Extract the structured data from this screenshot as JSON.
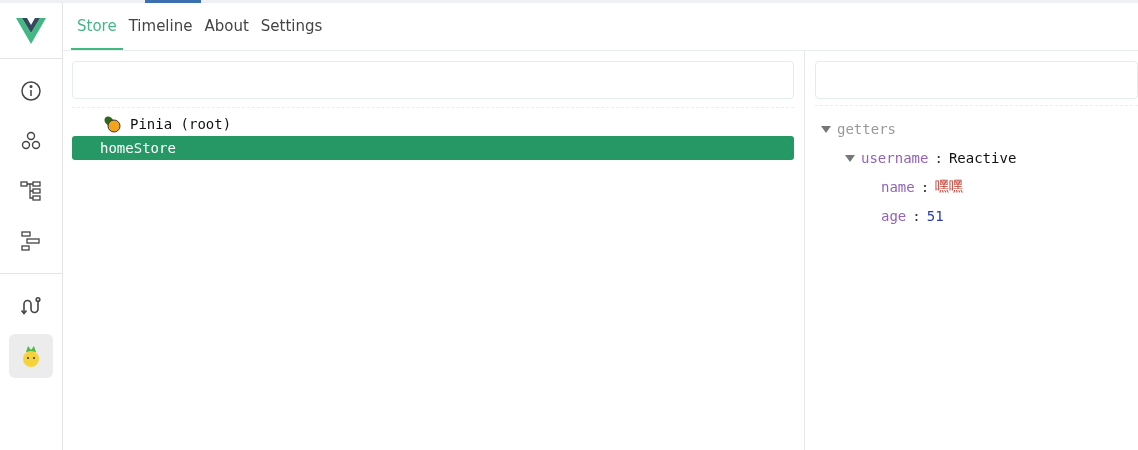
{
  "tabs": [
    {
      "label": "Store",
      "selected": true
    },
    {
      "label": "Timeline",
      "selected": false
    },
    {
      "label": "About",
      "selected": false
    },
    {
      "label": "Settings",
      "selected": false
    }
  ],
  "sidebar": {
    "groups": [
      [
        {
          "kind": "info",
          "selected": false
        },
        {
          "kind": "components",
          "selected": false
        },
        {
          "kind": "tree",
          "selected": false
        },
        {
          "kind": "timeline",
          "selected": false
        }
      ],
      [
        {
          "kind": "route",
          "selected": false
        },
        {
          "kind": "pinia",
          "selected": true
        }
      ]
    ]
  },
  "stores": [
    {
      "label": "Pinia (root)",
      "kind": "root",
      "selected": false
    },
    {
      "label": "homeStore",
      "kind": "store",
      "selected": true
    }
  ],
  "state": [
    {
      "key": "getters",
      "expanded": true,
      "children": [
        {
          "key": "username",
          "sep": ":",
          "value": "Reactive",
          "kind": "object",
          "expanded": true,
          "children": [
            {
              "key": "name",
              "sep": ":",
              "value": "嘿嘿",
              "kind": "string"
            },
            {
              "key": "age",
              "sep": ":",
              "value": "51",
              "kind": "number"
            }
          ]
        }
      ]
    }
  ]
}
